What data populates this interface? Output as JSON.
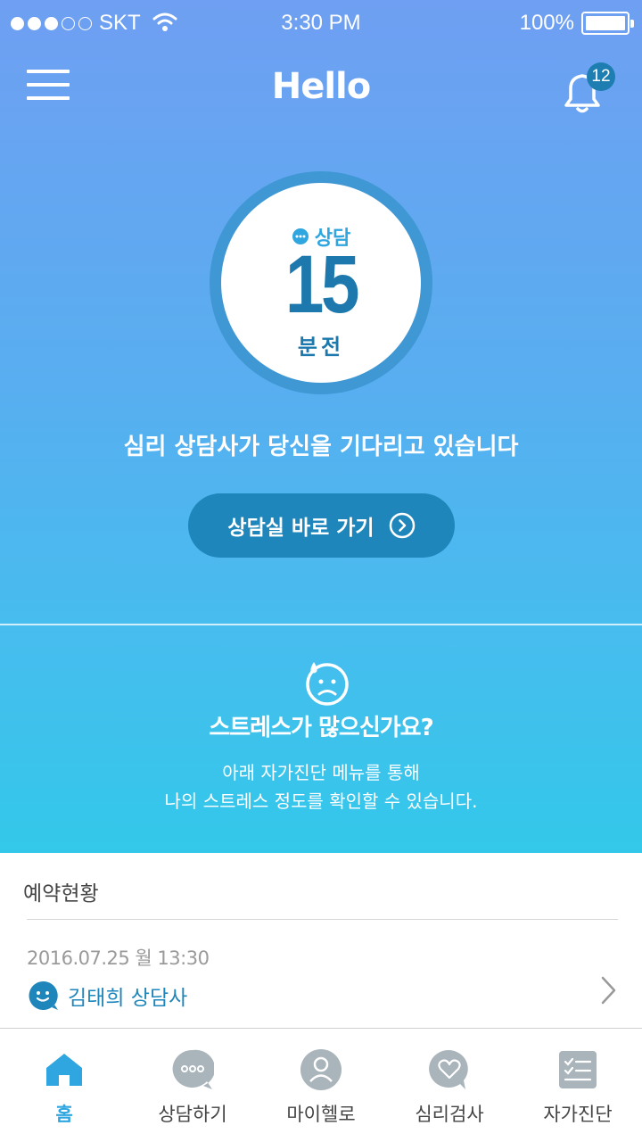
{
  "status_bar": {
    "carrier": "SKT",
    "time": "3:30 PM",
    "battery": "100%",
    "signal_strength": 3
  },
  "header": {
    "title": "Hello",
    "notification_count": "12",
    "menu_icon": "hamburger-icon",
    "bell_icon": "bell-icon"
  },
  "timer": {
    "label": "상담",
    "minutes": "15",
    "unit": "분전"
  },
  "waiting_message": "심리 상담사가 당신을 기다리고 있습니다",
  "enter_button": {
    "label": "상담실 바로 가기",
    "icon": "chevron-right-circle-icon"
  },
  "stress": {
    "icon": "worried-face-icon",
    "title": "스트레스가 많으신가요?",
    "desc_line1": "아래 자가진단 메뉴를 통해",
    "desc_line2": "나의 스트레스 정도를 확인할 수 있습니다."
  },
  "reservation": {
    "title": "예약현황",
    "datetime": "2016.07.25 월  13:30",
    "counselor": "김태희 상담사",
    "counselor_icon": "smile-bubble-icon"
  },
  "tabs": [
    {
      "label": "홈",
      "icon": "home-icon",
      "active": true
    },
    {
      "label": "상담하기",
      "icon": "chat-bubble-icon",
      "active": false
    },
    {
      "label": "마이헬로",
      "icon": "profile-icon",
      "active": false
    },
    {
      "label": "심리검사",
      "icon": "heart-bubble-icon",
      "active": false
    },
    {
      "label": "자가진단",
      "icon": "checklist-icon",
      "active": false
    }
  ],
  "colors": {
    "accent": "#2fa6e0",
    "button": "#1f86bb",
    "ring": "#3f98d4",
    "timer_text": "#1c78ad",
    "tab_inactive_icon": "#a9b4bb"
  }
}
